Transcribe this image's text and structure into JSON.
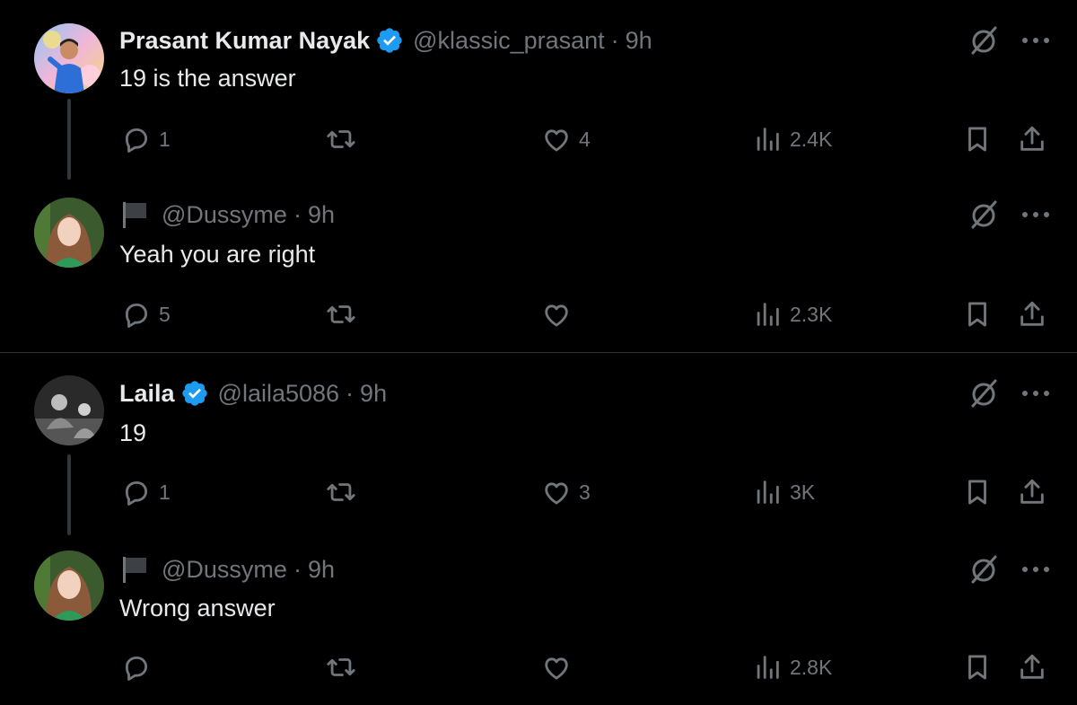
{
  "colors": {
    "background": "#000000",
    "text": "#e7e9ea",
    "muted": "#71767b",
    "verified": "#1d9bf0",
    "divider": "#2f3336"
  },
  "threads": [
    {
      "tweet": {
        "name": "Prasant Kumar Nayak",
        "verified": true,
        "handle": "@klassic_prasant",
        "dot": "·",
        "time": "9h",
        "text": "19 is the answer",
        "replies": "1",
        "retweets": "",
        "likes": "4",
        "views": "2.4K",
        "avatar_icon": "avatar-man-blue-jacket"
      },
      "reply": {
        "handle": "@Dussyme",
        "dot": "·",
        "time": "9h",
        "text": "Yeah you are right",
        "replies": "5",
        "retweets": "",
        "likes": "",
        "views": "2.3K",
        "avatar_icon": "avatar-woman-green"
      }
    },
    {
      "tweet": {
        "name": "Laila",
        "verified": true,
        "handle": "@laila5086",
        "dot": "·",
        "time": "9h",
        "text": "19",
        "replies": "1",
        "retweets": "",
        "likes": "3",
        "views": "3K",
        "avatar_icon": "avatar-grayscale-photo"
      },
      "reply": {
        "handle": "@Dussyme",
        "dot": "·",
        "time": "9h",
        "text": "Wrong answer",
        "replies": "",
        "retweets": "",
        "likes": "",
        "views": "2.8K",
        "avatar_icon": "avatar-woman-green"
      }
    }
  ]
}
